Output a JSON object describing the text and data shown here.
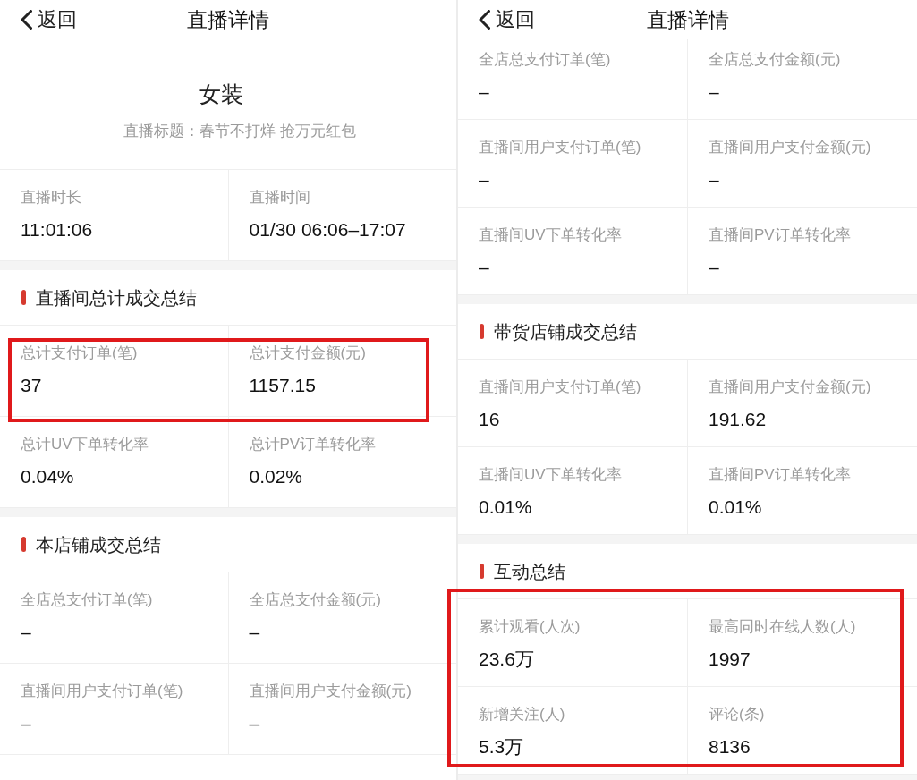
{
  "screens": [
    {
      "nav": {
        "back": "返回",
        "title": "直播详情"
      },
      "header": {
        "store_name": "女装",
        "subtitle": "直播标题：春节不打烊 抢万元红包"
      },
      "sections": [
        {
          "rows": [
            {
              "highlighted": false,
              "cells": [
                {
                  "label": "直播时长",
                  "value": "11:01:06"
                },
                {
                  "label": "直播时间",
                  "value": "01/30 06:06–17:07"
                }
              ]
            }
          ]
        },
        {
          "title": "直播间总计成交总结",
          "rows": [
            {
              "highlighted": true,
              "cells": [
                {
                  "label": "总计支付订单(笔)",
                  "value": "37"
                },
                {
                  "label": "总计支付金额(元)",
                  "value": "1157.15"
                }
              ]
            },
            {
              "highlighted": false,
              "cells": [
                {
                  "label": "总计UV下单转化率",
                  "value": "0.04%"
                },
                {
                  "label": "总计PV订单转化率",
                  "value": "0.02%"
                }
              ]
            }
          ]
        },
        {
          "title": "本店铺成交总结",
          "rows": [
            {
              "highlighted": false,
              "cells": [
                {
                  "label": "全店总支付订单(笔)",
                  "value": "–"
                },
                {
                  "label": "全店总支付金额(元)",
                  "value": "–"
                }
              ]
            },
            {
              "highlighted": false,
              "cells": [
                {
                  "label": "直播间用户支付订单(笔)",
                  "value": "–"
                },
                {
                  "label": "直播间用户支付金额(元)",
                  "value": "–"
                }
              ]
            }
          ]
        }
      ]
    },
    {
      "nav": {
        "back": "返回",
        "title": "直播详情"
      },
      "sections": [
        {
          "rows": [
            {
              "highlighted": false,
              "cells": [
                {
                  "label": "全店总支付订单(笔)",
                  "value": "–"
                },
                {
                  "label": "全店总支付金额(元)",
                  "value": "–"
                }
              ]
            },
            {
              "highlighted": false,
              "cells": [
                {
                  "label": "直播间用户支付订单(笔)",
                  "value": "–"
                },
                {
                  "label": "直播间用户支付金额(元)",
                  "value": "–"
                }
              ]
            },
            {
              "highlighted": false,
              "cells": [
                {
                  "label": "直播间UV下单转化率",
                  "value": "–"
                },
                {
                  "label": "直播间PV订单转化率",
                  "value": "–"
                }
              ]
            }
          ]
        },
        {
          "title": "带货店铺成交总结",
          "rows": [
            {
              "highlighted": false,
              "cells": [
                {
                  "label": "直播间用户支付订单(笔)",
                  "value": "16"
                },
                {
                  "label": "直播间用户支付金额(元)",
                  "value": "191.62"
                }
              ]
            },
            {
              "highlighted": false,
              "cells": [
                {
                  "label": "直播间UV下单转化率",
                  "value": "0.01%"
                },
                {
                  "label": "直播间PV订单转化率",
                  "value": "0.01%"
                }
              ]
            }
          ]
        },
        {
          "title": "互动总结",
          "rows": [
            {
              "highlighted": true,
              "cells": [
                {
                  "label": "累计观看(人次)",
                  "value": "23.6万"
                },
                {
                  "label": "最高同时在线人数(人)",
                  "value": "1997"
                }
              ]
            },
            {
              "highlighted": true,
              "cells": [
                {
                  "label": "新增关注(人)",
                  "value": "5.3万"
                },
                {
                  "label": "评论(条)",
                  "value": "8136"
                }
              ]
            }
          ]
        }
      ]
    }
  ]
}
